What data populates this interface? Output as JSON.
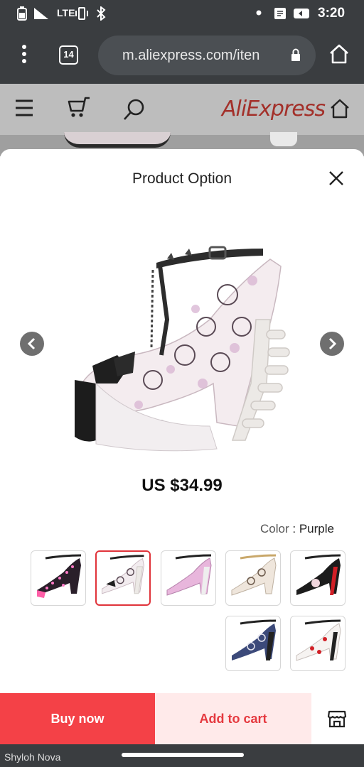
{
  "status_bar": {
    "time": "3:20",
    "network": "LTE",
    "icons": [
      "battery-icon",
      "signal-icon",
      "vibrate-icon",
      "bluetooth-icon",
      "notification-dot-icon",
      "message-icon",
      "youtube-icon"
    ]
  },
  "browser": {
    "url": "m.aliexpress.com/iten",
    "tab_count": "14",
    "icons": [
      "lock-icon",
      "home-icon",
      "menu-dots-icon"
    ]
  },
  "site_header": {
    "logo": "AliExpress",
    "icons": [
      "hamburger-icon",
      "cart-icon",
      "search-icon",
      "home-icon"
    ]
  },
  "sheet": {
    "title": "Product Option",
    "price": "US $34.99",
    "color_key": "Color",
    "color_value": "Purple",
    "swatches": [
      {
        "name": "black-red",
        "selected": false
      },
      {
        "name": "purple",
        "selected": false
      },
      {
        "name": "pink",
        "selected": false
      },
      {
        "name": "white-skull",
        "selected": true
      },
      {
        "name": "pink-dots",
        "selected": false
      },
      {
        "name": "white-red",
        "selected": false
      },
      {
        "name": "navy-skull",
        "selected": false
      }
    ]
  },
  "actions": {
    "add_to_cart": "Add to cart",
    "buy_now": "Buy now"
  },
  "watermark": "Shyloh Nova",
  "colors": {
    "accent": "#f44147",
    "accent_light": "#ffeaea",
    "chrome": "#3a3d40"
  }
}
